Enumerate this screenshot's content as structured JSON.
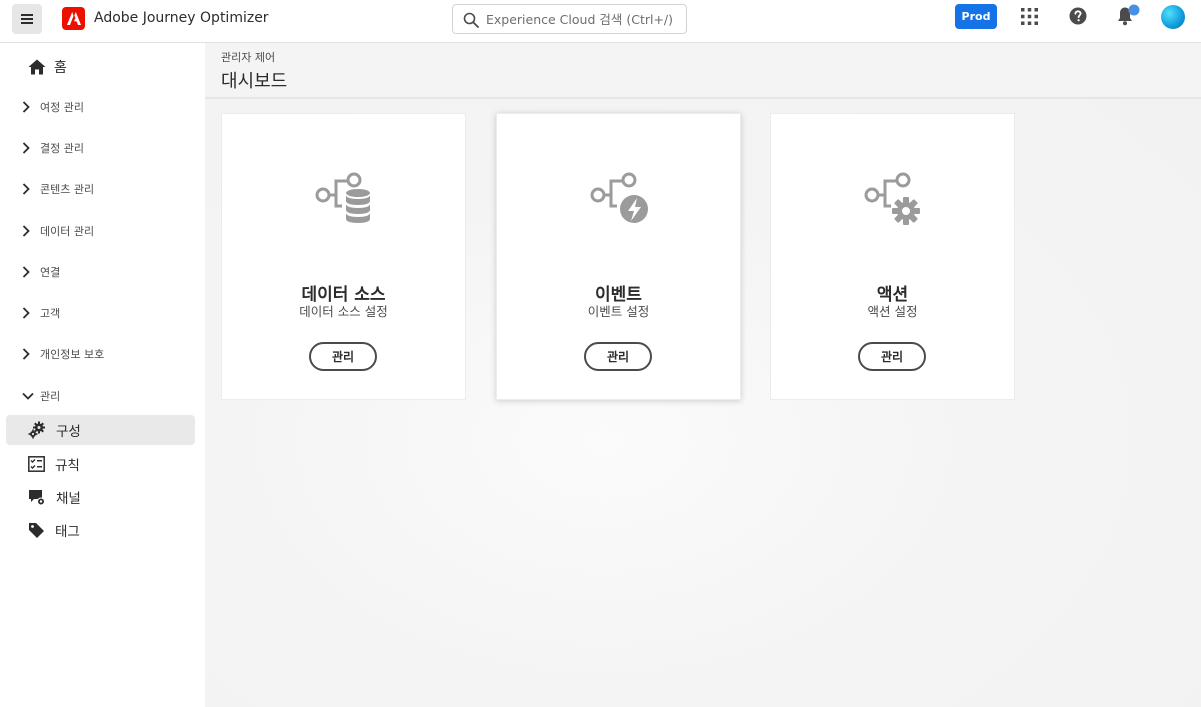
{
  "app": {
    "title": "Adobe Journey Optimizer"
  },
  "search": {
    "placeholder": "Experience Cloud 검색 (Ctrl+/)"
  },
  "header": {
    "environment": "Prod"
  },
  "colors": {
    "accent": "#1473e6",
    "logo": "#eb1000",
    "icon_gray": "#9b9b9b",
    "notification": "#4a90e2"
  },
  "sidebar": {
    "home": "홈",
    "groups": [
      {
        "label": "여정 관리"
      },
      {
        "label": "결정 관리"
      },
      {
        "label": "콘텐츠 관리"
      },
      {
        "label": "데이터 관리"
      },
      {
        "label": "연결"
      },
      {
        "label": "고객"
      },
      {
        "label": "개인정보 보호"
      },
      {
        "label": "관리"
      }
    ],
    "admin_items": [
      {
        "label": "구성",
        "icon": "gears-icon",
        "active": true
      },
      {
        "label": "규칙",
        "icon": "checklist-icon"
      },
      {
        "label": "채널",
        "icon": "channel-icon"
      },
      {
        "label": "태그",
        "icon": "tag-icon"
      }
    ]
  },
  "page": {
    "breadcrumb": "관리자 제어",
    "title": "대시보드"
  },
  "cards": [
    {
      "title": "데이터 소스",
      "subtitle": "데이터 소스 설정",
      "button": "관리",
      "icon": "data-source-icon"
    },
    {
      "title": "이벤트",
      "subtitle": "이벤트 설정",
      "button": "관리",
      "icon": "event-icon"
    },
    {
      "title": "액션",
      "subtitle": "액션 설정",
      "button": "관리",
      "icon": "action-icon"
    }
  ]
}
